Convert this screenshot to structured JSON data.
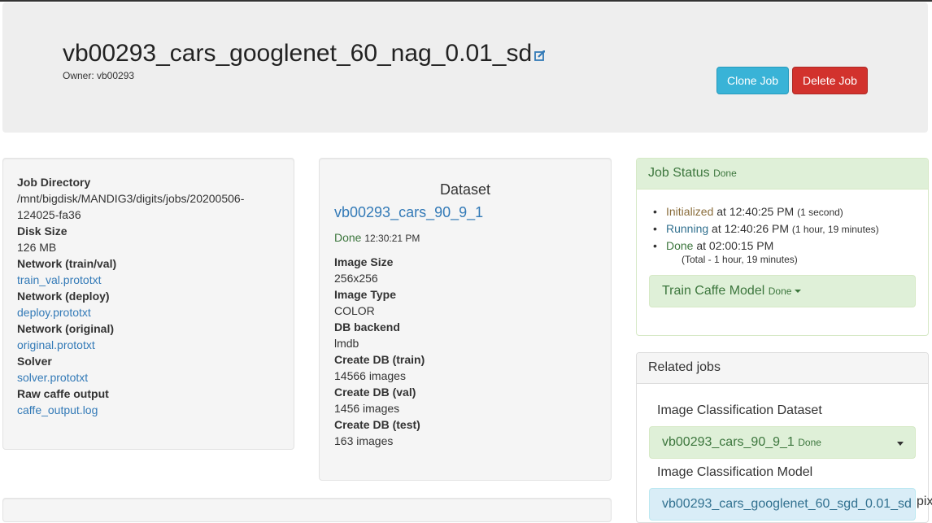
{
  "header": {
    "title": "vb00293_cars_googlenet_60_nag_0.01_sd",
    "owner": "Owner: vb00293",
    "clone_label": "Clone Job",
    "delete_label": "Delete Job"
  },
  "job_info": {
    "job_dir_label": "Job Directory",
    "job_dir_line1": "/mnt/bigdisk/MANDIG3/digits/jobs/20200506-",
    "job_dir_line2": "124025-fa36",
    "disk_size_label": "Disk Size",
    "disk_size_value": "126 MB",
    "net_trainval_label": "Network (train/val)",
    "net_trainval_link": "train_val.prototxt",
    "net_deploy_label": "Network (deploy)",
    "net_deploy_link": "deploy.prototxt",
    "net_original_label": "Network (original)",
    "net_original_link": "original.prototxt",
    "solver_label": "Solver",
    "solver_link": "solver.prototxt",
    "raw_output_label": "Raw caffe output",
    "raw_output_link": "caffe_output.log"
  },
  "dataset": {
    "heading": "Dataset",
    "name": "vb00293_cars_90_9_1",
    "status": "Done",
    "status_time": "12:30:21 PM",
    "image_size_label": "Image Size",
    "image_size_value": "256x256",
    "image_type_label": "Image Type",
    "image_type_value": "COLOR",
    "db_backend_label": "DB backend",
    "db_backend_value": "lmdb",
    "db_train_label": "Create DB (train)",
    "db_train_value": "14566 images",
    "db_val_label": "Create DB (val)",
    "db_val_value": "1456 images",
    "db_test_label": "Create DB (test)",
    "db_test_value": "163 images"
  },
  "job_status": {
    "title": "Job Status",
    "state": "Done",
    "items": [
      {
        "name": "Initialized",
        "at": "at 12:40:25 PM",
        "duration": "(1 second)"
      },
      {
        "name": "Running",
        "at": "at 12:40:26 PM",
        "duration": "(1 hour, 19 minutes)"
      },
      {
        "name": "Done",
        "at": "at 02:00:15 PM",
        "duration": ""
      }
    ],
    "total": "(Total - 1 hour, 19 minutes)",
    "task_label": "Train Caffe Model",
    "task_state": "Done"
  },
  "related": {
    "title": "Related jobs",
    "dataset_heading": "Image Classification Dataset",
    "dataset_job": "vb00293_cars_90_9_1",
    "dataset_job_state": "Done",
    "model_heading": "Image Classification Model",
    "model_job": "vb00293_cars_googlenet_60_sgd_0.01_sd",
    "overflow_text": "pix"
  },
  "colors": {
    "clone": "#39b3d7",
    "delete": "#d2322d",
    "link": "#337ab7",
    "success_bg": "#dff0d8",
    "success_text": "#3c763d"
  }
}
